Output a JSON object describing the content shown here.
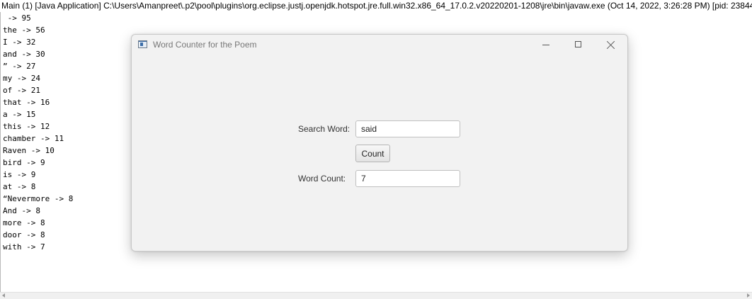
{
  "console": {
    "title": "Main (1) [Java Application] C:\\Users\\Amanpreet\\.p2\\pool\\plugins\\org.eclipse.justj.openjdk.hotspot.jre.full.win32.x86_64_17.0.2.v20220201-1208\\jre\\bin\\javaw.exe  (Oct 14, 2022, 3:26:28 PM) [pid: 23844]",
    "lines": [
      " -> 95",
      "the -> 56",
      "I -> 32",
      "and -> 30",
      "” -> 27",
      "my -> 24",
      "of -> 21",
      "that -> 16",
      "a -> 15",
      "this -> 12",
      "chamber -> 11",
      "Raven -> 10",
      "bird -> 9",
      "is -> 9",
      "at -> 8",
      "“Nevermore -> 8",
      "And -> 8",
      "more -> 8",
      "door -> 8",
      "with -> 7"
    ]
  },
  "window": {
    "title": "Word Counter for the Poem",
    "icon": "java-app-icon",
    "controls": [
      "minimize-icon",
      "maximize-icon",
      "close-icon"
    ]
  },
  "form": {
    "search_label": "Search Word:",
    "search_value": "said",
    "count_button": "Count",
    "count_label": "Word Count:",
    "count_value": "7"
  }
}
